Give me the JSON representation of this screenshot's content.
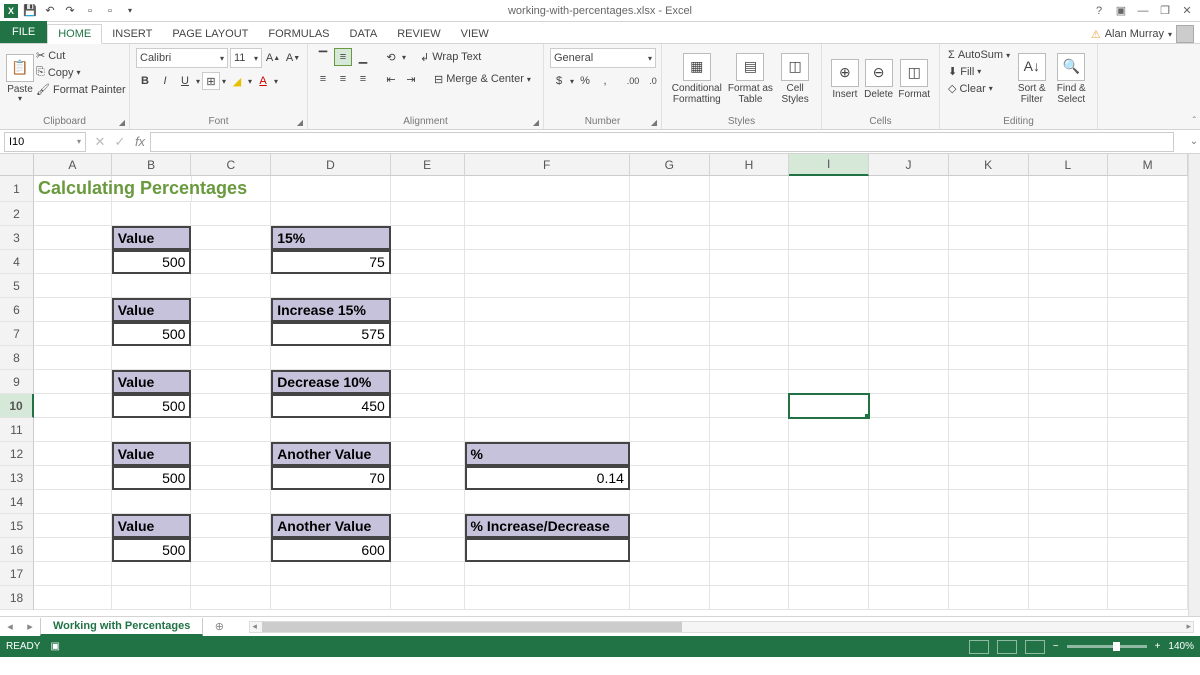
{
  "titlebar": {
    "title": "working-with-percentages.xlsx - Excel"
  },
  "tabs": {
    "file": "FILE",
    "home": "HOME",
    "insert": "INSERT",
    "pagelayout": "PAGE LAYOUT",
    "formulas": "FORMULAS",
    "data": "DATA",
    "review": "REVIEW",
    "view": "VIEW"
  },
  "user": {
    "name": "Alan Murray"
  },
  "ribbon": {
    "clipboard": {
      "label": "Clipboard",
      "paste": "Paste",
      "cut": "Cut",
      "copy": "Copy",
      "painter": "Format Painter"
    },
    "font": {
      "label": "Font",
      "name": "Calibri",
      "size": "11"
    },
    "alignment": {
      "label": "Alignment",
      "wrap": "Wrap Text",
      "merge": "Merge & Center"
    },
    "number": {
      "label": "Number",
      "format": "General"
    },
    "styles": {
      "label": "Styles",
      "cond": "Conditional Formatting",
      "fas": "Format as Table",
      "cell": "Cell Styles"
    },
    "cells": {
      "label": "Cells",
      "insert": "Insert",
      "delete": "Delete",
      "format": "Format"
    },
    "editing": {
      "label": "Editing",
      "autosum": "AutoSum",
      "fill": "Fill",
      "clear": "Clear",
      "sort": "Sort & Filter",
      "find": "Find & Select"
    }
  },
  "namebox": "I10",
  "columns": [
    "A",
    "B",
    "C",
    "D",
    "E",
    "F",
    "G",
    "H",
    "I",
    "J",
    "K",
    "L",
    "M"
  ],
  "rows_visible": 18,
  "active_col": "I",
  "active_row": 10,
  "sheet": {
    "title": "Calculating Percentages",
    "b3": "Value",
    "d3": "15%",
    "b4": "500",
    "d4": "75",
    "b6": "Value",
    "d6": "Increase 15%",
    "b7": "500",
    "d7": "575",
    "b9": "Value",
    "d9": "Decrease 10%",
    "b10": "500",
    "d10": "450",
    "b12": "Value",
    "d12": "Another Value",
    "f12": "%",
    "b13": "500",
    "d13": "70",
    "f13": "0.14",
    "b15": "Value",
    "d15": "Another Value",
    "f15": "% Increase/Decrease",
    "b16": "500",
    "d16": "600",
    "f16": ""
  },
  "sheettab": "Working with Percentages",
  "status": {
    "ready": "READY",
    "zoom": "140%"
  }
}
